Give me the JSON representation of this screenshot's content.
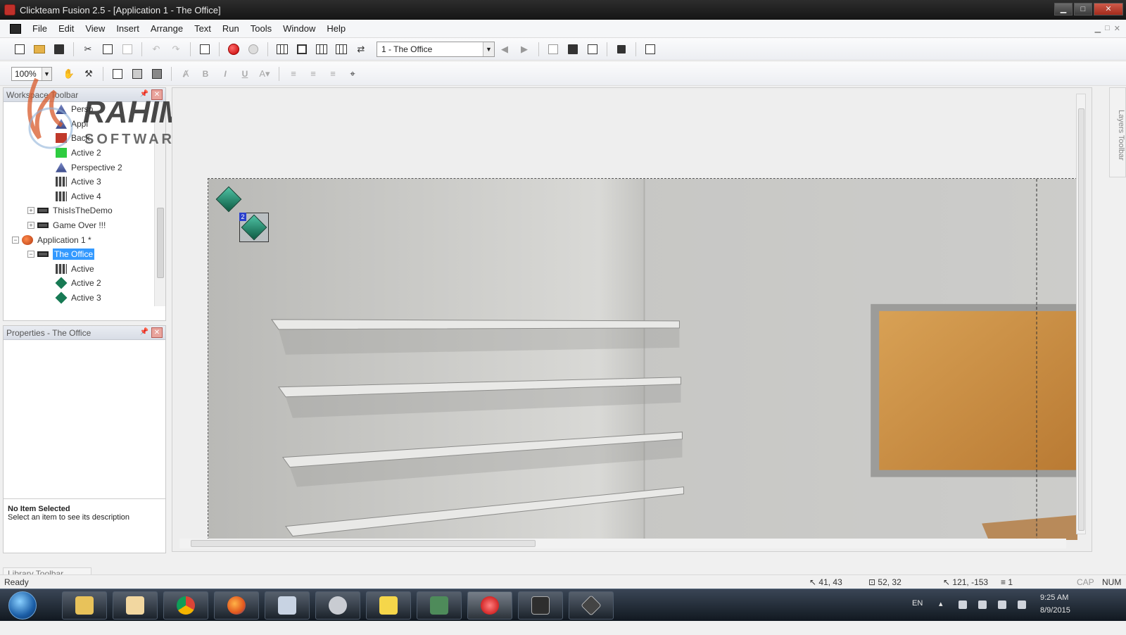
{
  "window": {
    "title": "Clickteam Fusion 2.5 - [Application 1 - The Office]",
    "controls": {
      "minimize": "▁",
      "maximize": "□",
      "close": "✕"
    }
  },
  "menu": [
    "File",
    "Edit",
    "View",
    "Insert",
    "Arrange",
    "Text",
    "Run",
    "Tools",
    "Window",
    "Help"
  ],
  "toolbar": {
    "frame_select": "1 - The Office",
    "zoom": "100%",
    "bold": "B",
    "italic": "I",
    "underline": "U"
  },
  "workspace": {
    "title": "Workspace Toolbar",
    "tree": [
      {
        "label": "Persp",
        "icon": "perspective-icon",
        "indent": 3
      },
      {
        "label": "Appl",
        "icon": "active-icon",
        "indent": 3
      },
      {
        "label": "Back",
        "icon": "backdrop-icon",
        "indent": 3
      },
      {
        "label": "Active 2",
        "icon": "active-green-icon",
        "indent": 3
      },
      {
        "label": "Perspective 2",
        "icon": "perspective-icon",
        "indent": 3
      },
      {
        "label": "Active 3",
        "icon": "active-film-icon",
        "indent": 3
      },
      {
        "label": "Active 4",
        "icon": "active-film-icon",
        "indent": 3
      },
      {
        "label": "ThisIsTheDemo",
        "icon": "frame-icon",
        "indent": 2,
        "expander": "+"
      },
      {
        "label": "Game Over !!!",
        "icon": "frame-icon",
        "indent": 2,
        "expander": "+"
      },
      {
        "label": "Application 1 *",
        "icon": "application-icon",
        "indent": 1,
        "expander": "−"
      },
      {
        "label": "The Office",
        "icon": "frame-icon",
        "indent": 2,
        "expander": "−",
        "selected": true
      },
      {
        "label": "Active",
        "icon": "active-film-icon",
        "indent": 3
      },
      {
        "label": "Active 2",
        "icon": "diamond-icon",
        "indent": 3
      },
      {
        "label": "Active 3",
        "icon": "diamond-icon",
        "indent": 3
      }
    ]
  },
  "properties": {
    "title": "Properties - The Office",
    "desc_title": "No Item Selected",
    "desc_text": "Select an item to see its description"
  },
  "library": {
    "label": "Library Toolbar"
  },
  "layers": {
    "label": "Layers Toolbar"
  },
  "watermark": {
    "line1": "RAHIM",
    "line2": "SOFTWARE"
  },
  "status": {
    "ready": "Ready",
    "coords": "41, 43",
    "size": "52, 32",
    "pos": "121, -153",
    "layer": "1",
    "cap": "CAP",
    "num": "NUM"
  },
  "taskbar": {
    "lang": "EN",
    "time": "9:25 AM",
    "date": "8/9/2015",
    "apps": [
      "explorer-icon",
      "media-player-icon",
      "chrome-icon",
      "firefox-icon",
      "paint-icon",
      "security-icon",
      "help-icon",
      "monitor-icon",
      "clickteam-icon",
      "game-icon",
      "diamond-app-icon"
    ]
  },
  "colors": {
    "selection": "#3399ff",
    "diamond": "#177a54",
    "corkboard": "#c98a3e"
  }
}
